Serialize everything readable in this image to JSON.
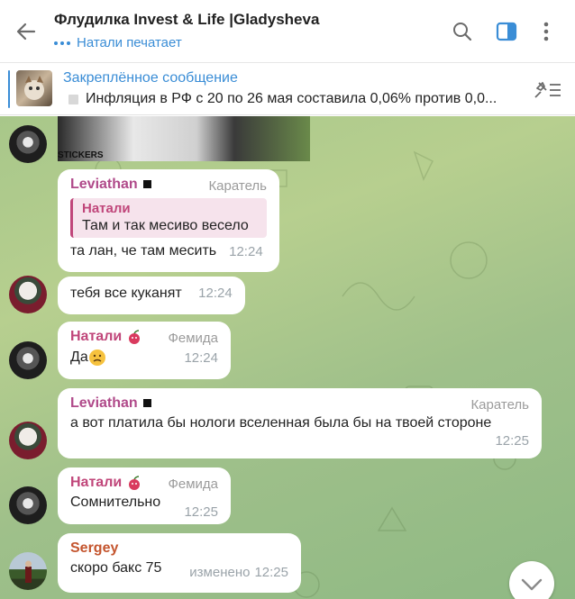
{
  "header": {
    "title": "Флудилка Invest & Life |Gladysheva",
    "status": "Натали печатает"
  },
  "pinned": {
    "label": "Закреплённое сообщение",
    "text": "Инфляция в РФ с 20 по 26 мая составила 0,06% против 0,0..."
  },
  "sticker": {
    "label": "STICKERS"
  },
  "messages": [
    {
      "author": "Leviathan",
      "role": "Каратель",
      "reply": {
        "author": "Натали",
        "text": "Там и так месиво весело"
      },
      "text": "та лан, че там месить",
      "time": "12:24"
    },
    {
      "text": "тебя все куканят",
      "time": "12:24"
    },
    {
      "author": "Натали",
      "role": "Фемида",
      "text": "Да",
      "emoji": "🙁",
      "time": "12:24"
    },
    {
      "author": "Leviathan",
      "role": "Каратель",
      "text": "а вот платила бы нологи вселенная была бы на твоей стороне",
      "time": "12:25"
    },
    {
      "author": "Натали",
      "role": "Фемида",
      "text": "Сомнительно",
      "time": "12:25"
    },
    {
      "author": "Sergey",
      "text": "скоро бакс 75",
      "edited": "изменено",
      "time": "12:25"
    }
  ],
  "colors": {
    "accent": "#3a8dd6",
    "leviathan": "#b04a8a",
    "natali": "#c0467a",
    "sergey": "#c4552e"
  }
}
